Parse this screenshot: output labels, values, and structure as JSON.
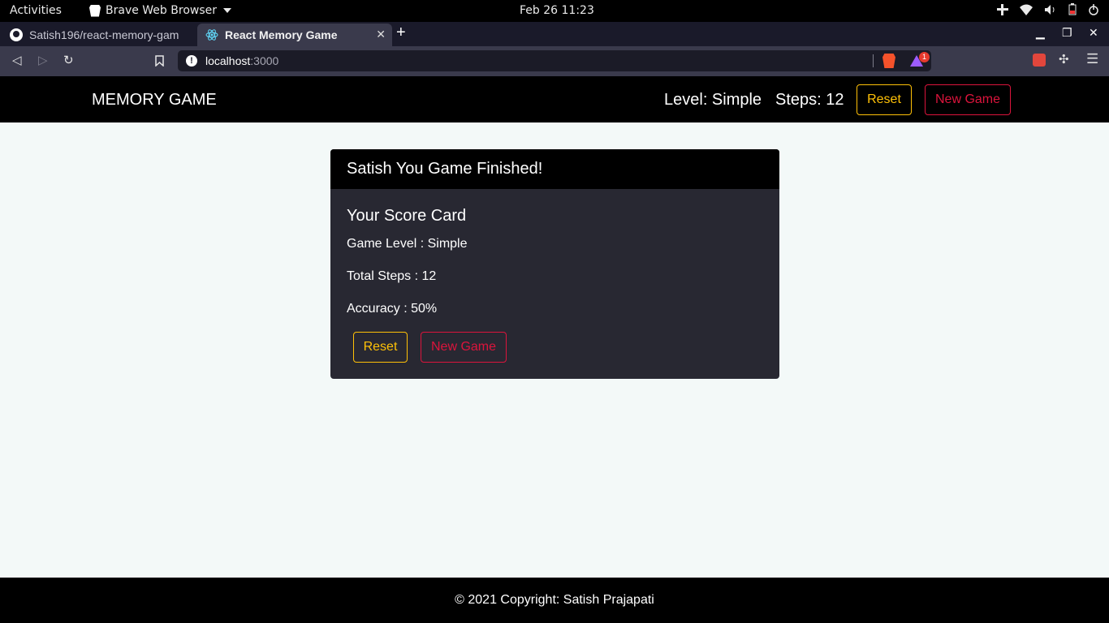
{
  "system": {
    "activities": "Activities",
    "app_menu": "Brave Web Browser",
    "clock": "Feb 26  11:23"
  },
  "browser": {
    "tabs": [
      {
        "title": "Satish196/react-memory-gam",
        "icon": "github-icon"
      },
      {
        "title": "React Memory Game",
        "icon": "react-icon"
      }
    ],
    "url_host": "localhost",
    "url_port": ":3000",
    "rewards_badge": "1"
  },
  "navbar": {
    "brand": "MEMORY GAME",
    "level": "Level: Simple",
    "steps": "Steps: 12",
    "reset_label": "Reset",
    "new_game_label": "New Game"
  },
  "result_card": {
    "header": "Satish You Game Finished!",
    "title": "Your Score Card",
    "game_level": "Game Level : Simple",
    "total_steps": "Total Steps : 12",
    "accuracy": "Accuracy : 50%",
    "reset_label": "Reset",
    "new_game_label": "New Game"
  },
  "footer": {
    "text": "© 2021 Copyright: Satish Prajapati"
  },
  "colors": {
    "warning": "#ffc107",
    "danger": "#dc143c",
    "card_body": "#282832",
    "page_bg": "#f3f9f8"
  }
}
